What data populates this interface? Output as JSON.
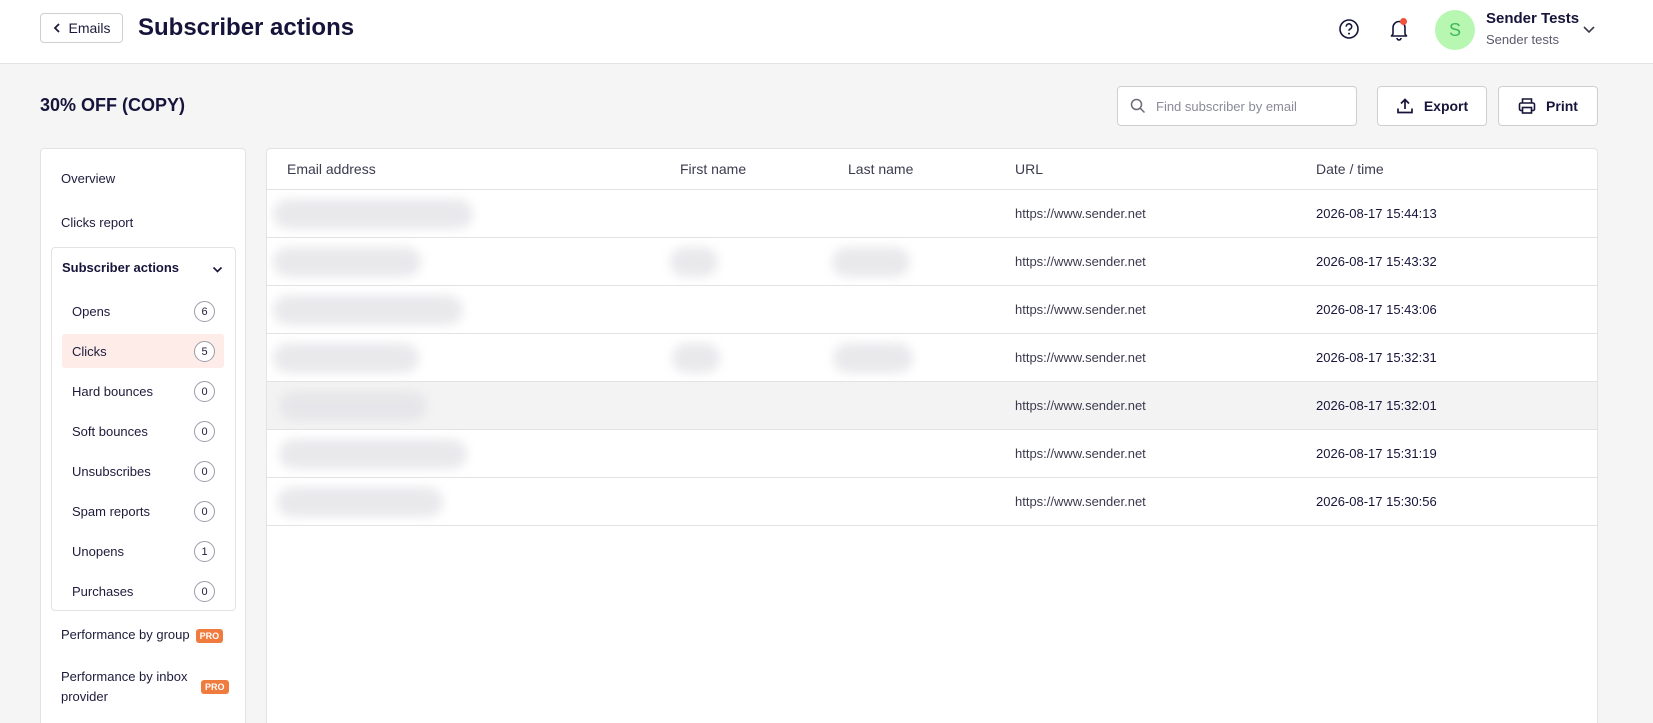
{
  "header": {
    "back_label": "Emails",
    "title": "Subscriber actions",
    "user": {
      "initial": "S",
      "name": "Sender Tests",
      "sub": "Sender tests"
    },
    "icons": {
      "help": "help-icon",
      "notifications": "bell-icon",
      "menu": "chevron-down-icon"
    },
    "notification_dot_color": "#f0513b"
  },
  "toolbar": {
    "campaign_title": "30% OFF (COPY)",
    "search_placeholder": "Find subscriber by email",
    "export_label": "Export",
    "print_label": "Print"
  },
  "sidebar": {
    "links": [
      {
        "label": "Overview"
      },
      {
        "label": "Clicks report"
      }
    ],
    "group": {
      "label": "Subscriber actions",
      "items": [
        {
          "label": "Opens",
          "count": "6"
        },
        {
          "label": "Clicks",
          "count": "5",
          "active": true
        },
        {
          "label": "Hard bounces",
          "count": "0"
        },
        {
          "label": "Soft bounces",
          "count": "0"
        },
        {
          "label": "Unsubscribes",
          "count": "0"
        },
        {
          "label": "Spam reports",
          "count": "0"
        },
        {
          "label": "Unopens",
          "count": "1"
        },
        {
          "label": "Purchases",
          "count": "0"
        }
      ]
    },
    "pro_links": [
      {
        "label": "Performance by group",
        "badge": "PRO"
      },
      {
        "label": "Performance by inbox provider",
        "badge": "PRO"
      }
    ]
  },
  "table": {
    "columns": [
      "Email address",
      "First name",
      "Last name",
      "URL",
      "Date / time"
    ],
    "rows": [
      {
        "url": "https://www.sender.net",
        "datetime": "2026-08-17 15:44:13"
      },
      {
        "url": "https://www.sender.net",
        "datetime": "2026-08-17 15:43:32"
      },
      {
        "url": "https://www.sender.net",
        "datetime": "2026-08-17 15:43:06"
      },
      {
        "url": "https://www.sender.net",
        "datetime": "2026-08-17 15:32:31"
      },
      {
        "url": "https://www.sender.net",
        "datetime": "2026-08-17 15:32:01"
      },
      {
        "url": "https://www.sender.net",
        "datetime": "2026-08-17 15:31:19"
      },
      {
        "url": "https://www.sender.net",
        "datetime": "2026-08-17 15:30:56"
      }
    ]
  },
  "colors": {
    "accent_active": "#fdece8",
    "pro_badge": "#f07b3f",
    "avatar_bg": "#b8f7b2",
    "text_primary": "#16143a"
  }
}
